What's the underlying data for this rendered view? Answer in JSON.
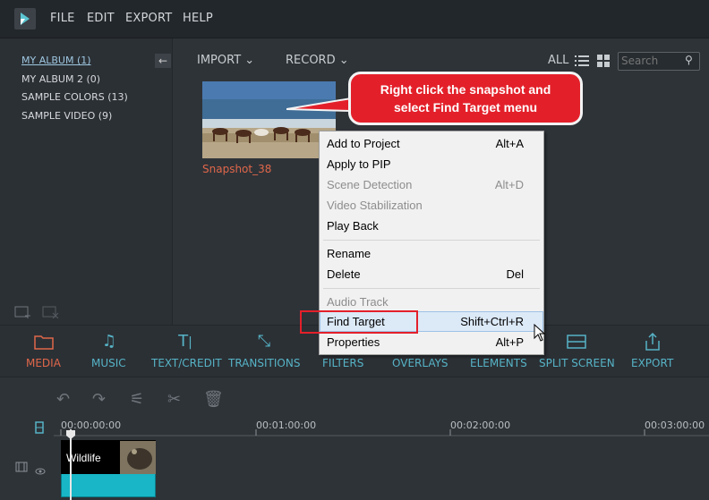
{
  "menubar": {
    "items": [
      "FILE",
      "EDIT",
      "EXPORT",
      "HELP"
    ]
  },
  "sidebar": {
    "albums": [
      {
        "label": "MY ALBUM (1)"
      },
      {
        "label": "MY ALBUM 2 (0)"
      },
      {
        "label": "SAMPLE COLORS (13)"
      },
      {
        "label": "SAMPLE VIDEO (9)"
      }
    ]
  },
  "media_toolbar": {
    "import_label": "IMPORT",
    "record_label": "RECORD",
    "filter_all": "ALL",
    "search_placeholder": "Search"
  },
  "media": {
    "snapshot_label": "Snapshot_38"
  },
  "callout": {
    "line1": "Right click the snapshot and",
    "line2": "select Find Target menu"
  },
  "context_menu": {
    "items": [
      {
        "label": "Add to Project",
        "shortcut": "Alt+A",
        "enabled": true
      },
      {
        "label": "Apply to PIP",
        "shortcut": "",
        "enabled": true
      },
      {
        "label": "Scene Detection",
        "shortcut": "Alt+D",
        "enabled": false
      },
      {
        "label": "Video Stabilization",
        "shortcut": "",
        "enabled": false
      },
      {
        "label": "Play Back",
        "shortcut": "",
        "enabled": true
      },
      {
        "label": "Rename",
        "shortcut": "",
        "enabled": true
      },
      {
        "label": "Delete",
        "shortcut": "Del",
        "enabled": true
      },
      {
        "label": "Audio Track",
        "shortcut": "",
        "enabled": false
      },
      {
        "label": "Find Target",
        "shortcut": "Shift+Ctrl+R",
        "enabled": true
      },
      {
        "label": "Properties",
        "shortcut": "Alt+P",
        "enabled": true
      }
    ]
  },
  "tabs": [
    {
      "label": "MEDIA",
      "icon": "folder-icon",
      "active": true
    },
    {
      "label": "MUSIC",
      "icon": "music-note-icon"
    },
    {
      "label": "TEXT/CREDIT",
      "icon": "text-icon"
    },
    {
      "label": "TRANSITIONS",
      "icon": "transitions-icon"
    },
    {
      "label": "FILTERS",
      "icon": "filters-icon"
    },
    {
      "label": "OVERLAYS",
      "icon": "overlays-icon"
    },
    {
      "label": "ELEMENTS",
      "icon": "elements-icon"
    },
    {
      "label": "SPLIT SCREEN",
      "icon": "split-screen-icon"
    },
    {
      "label": "EXPORT",
      "icon": "export-icon"
    }
  ],
  "timeline": {
    "ticks": [
      "00:00:00:00",
      "00:01:00:00",
      "00:02:00:00",
      "00:03:00:00"
    ],
    "clip_label": "Wildlife"
  },
  "colors": {
    "accent": "#56b3c6",
    "active_tab": "#e0674a",
    "callout": "#e3202a"
  }
}
